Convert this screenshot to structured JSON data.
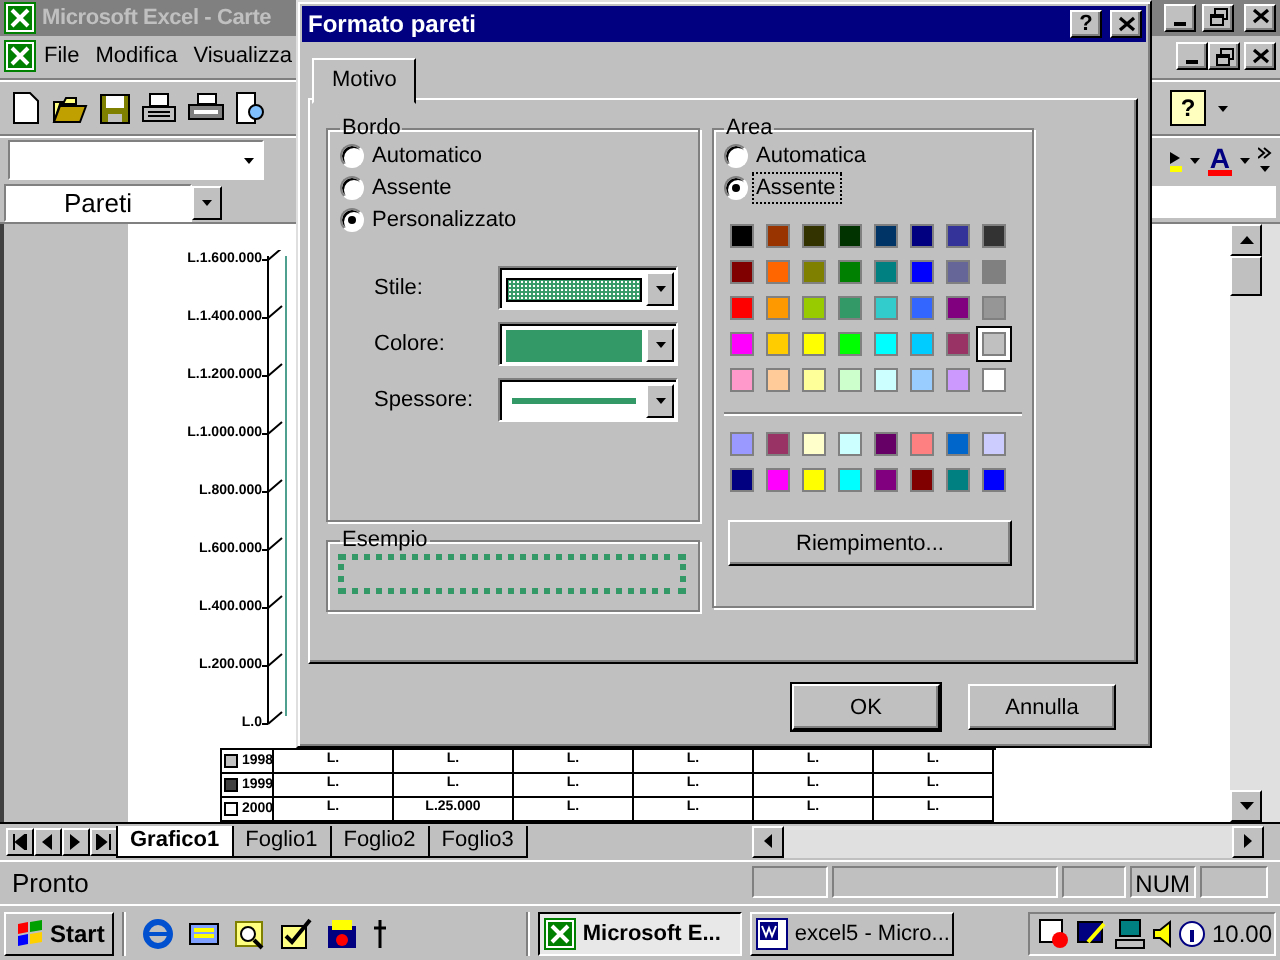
{
  "app": {
    "title": "Microsoft Excel - Carte",
    "menu": [
      "File",
      "Modifica",
      "Visualizza"
    ],
    "help_glyph": "?",
    "font_color_glyph": "A",
    "name_box": "Pareti"
  },
  "chart": {
    "axis_labels": [
      "L.1.600.000",
      "L.1.400.000",
      "L.1.200.000",
      "L.1.000.000",
      "L.800.000",
      "L.600.000",
      "L.400.000",
      "L.200.000",
      "L.0"
    ],
    "table": {
      "rows": [
        {
          "label": "1998",
          "color": "#c0c0c0",
          "cells": [
            "L.",
            "L.",
            "L.",
            "L.",
            "L.",
            "L."
          ]
        },
        {
          "label": "1999",
          "color": "#404040",
          "cells": [
            "L.",
            "L.",
            "L.",
            "L.",
            "L.",
            "L."
          ]
        },
        {
          "label": "2000",
          "color": "#ffffff",
          "cells": [
            "L.",
            "L.25.000",
            "L.",
            "L.",
            "L.",
            "L."
          ]
        }
      ]
    }
  },
  "sheet_tabs": [
    {
      "label": "Grafico1",
      "selected": true
    },
    {
      "label": "Foglio1",
      "selected": false
    },
    {
      "label": "Foglio2",
      "selected": false
    },
    {
      "label": "Foglio3",
      "selected": false
    }
  ],
  "status_bar": {
    "text": "Pronto",
    "num": "NUM"
  },
  "taskbar": {
    "start": "Start",
    "tasks": [
      {
        "label": "Microsoft E...",
        "kind": "excel",
        "selected": true
      },
      {
        "label": "excel5 - Micro...",
        "kind": "word",
        "selected": false
      }
    ],
    "clock": "10.00"
  },
  "dialog": {
    "title": "Formato pareti",
    "help_glyph": "?",
    "tabs": [
      {
        "label": "Motivo",
        "selected": true
      }
    ],
    "border": {
      "title": "Bordo",
      "options": [
        {
          "label": "Automatico",
          "selected": false
        },
        {
          "label": "Assente",
          "selected": false
        },
        {
          "label": "Personalizzato",
          "selected": true
        }
      ],
      "fields": [
        {
          "kind": "style",
          "label": "Stile:",
          "color": "#339966"
        },
        {
          "kind": "color",
          "label": "Colore:",
          "color": "#339966"
        },
        {
          "kind": "weight",
          "label": "Spessore:",
          "color": "#339966"
        }
      ]
    },
    "sample": {
      "title": "Esempio",
      "color": "#339966"
    },
    "area": {
      "title": "Area",
      "options": [
        {
          "label": "Automatica",
          "selected": false,
          "focused": false
        },
        {
          "label": "Assente",
          "selected": true,
          "focused": true
        }
      ],
      "palette": [
        [
          {
            "color": "#000000",
            "selected": false
          },
          {
            "color": "#993300",
            "selected": false
          },
          {
            "color": "#333300",
            "selected": false
          },
          {
            "color": "#003300",
            "selected": false
          },
          {
            "color": "#003366",
            "selected": false
          },
          {
            "color": "#000080",
            "selected": false
          },
          {
            "color": "#333399",
            "selected": false
          },
          {
            "color": "#333333",
            "selected": false
          }
        ],
        [
          {
            "color": "#800000",
            "selected": false
          },
          {
            "color": "#ff6600",
            "selected": false
          },
          {
            "color": "#808000",
            "selected": false
          },
          {
            "color": "#008000",
            "selected": false
          },
          {
            "color": "#008080",
            "selected": false
          },
          {
            "color": "#0000ff",
            "selected": false
          },
          {
            "color": "#666699",
            "selected": false
          },
          {
            "color": "#808080",
            "selected": false
          }
        ],
        [
          {
            "color": "#ff0000",
            "selected": false
          },
          {
            "color": "#ff9900",
            "selected": false
          },
          {
            "color": "#99cc00",
            "selected": false
          },
          {
            "color": "#339966",
            "selected": false
          },
          {
            "color": "#33cccc",
            "selected": false
          },
          {
            "color": "#3366ff",
            "selected": false
          },
          {
            "color": "#800080",
            "selected": false
          },
          {
            "color": "#969696",
            "selected": false
          }
        ],
        [
          {
            "color": "#ff00ff",
            "selected": false
          },
          {
            "color": "#ffcc00",
            "selected": false
          },
          {
            "color": "#ffff00",
            "selected": false
          },
          {
            "color": "#00ff00",
            "selected": false
          },
          {
            "color": "#00ffff",
            "selected": false
          },
          {
            "color": "#00ccff",
            "selected": false
          },
          {
            "color": "#993366",
            "selected": false
          },
          {
            "color": "#c0c0c0",
            "selected": true
          }
        ],
        [
          {
            "color": "#ff99cc",
            "selected": false
          },
          {
            "color": "#ffcc99",
            "selected": false
          },
          {
            "color": "#ffff99",
            "selected": false
          },
          {
            "color": "#ccffcc",
            "selected": false
          },
          {
            "color": "#ccffff",
            "selected": false
          },
          {
            "color": "#99ccff",
            "selected": false
          },
          {
            "color": "#cc99ff",
            "selected": false
          },
          {
            "color": "#ffffff",
            "selected": false
          }
        ]
      ],
      "chart_palette": [
        [
          {
            "color": "#9999ff",
            "selected": false
          },
          {
            "color": "#993366",
            "selected": false
          },
          {
            "color": "#ffffcc",
            "selected": false
          },
          {
            "color": "#ccffff",
            "selected": false
          },
          {
            "color": "#660066",
            "selected": false
          },
          {
            "color": "#ff8080",
            "selected": false
          },
          {
            "color": "#0066cc",
            "selected": false
          },
          {
            "color": "#ccccff",
            "selected": false
          }
        ],
        [
          {
            "color": "#000080",
            "selected": false
          },
          {
            "color": "#ff00ff",
            "selected": false
          },
          {
            "color": "#ffff00",
            "selected": false
          },
          {
            "color": "#00ffff",
            "selected": false
          },
          {
            "color": "#800080",
            "selected": false
          },
          {
            "color": "#800000",
            "selected": false
          },
          {
            "color": "#008080",
            "selected": false
          },
          {
            "color": "#0000ff",
            "selected": false
          }
        ]
      ],
      "fill_button": "Riempimento..."
    },
    "buttons": [
      {
        "label": "OK",
        "kind": "default"
      },
      {
        "label": "Annulla",
        "kind": "normal"
      }
    ]
  }
}
